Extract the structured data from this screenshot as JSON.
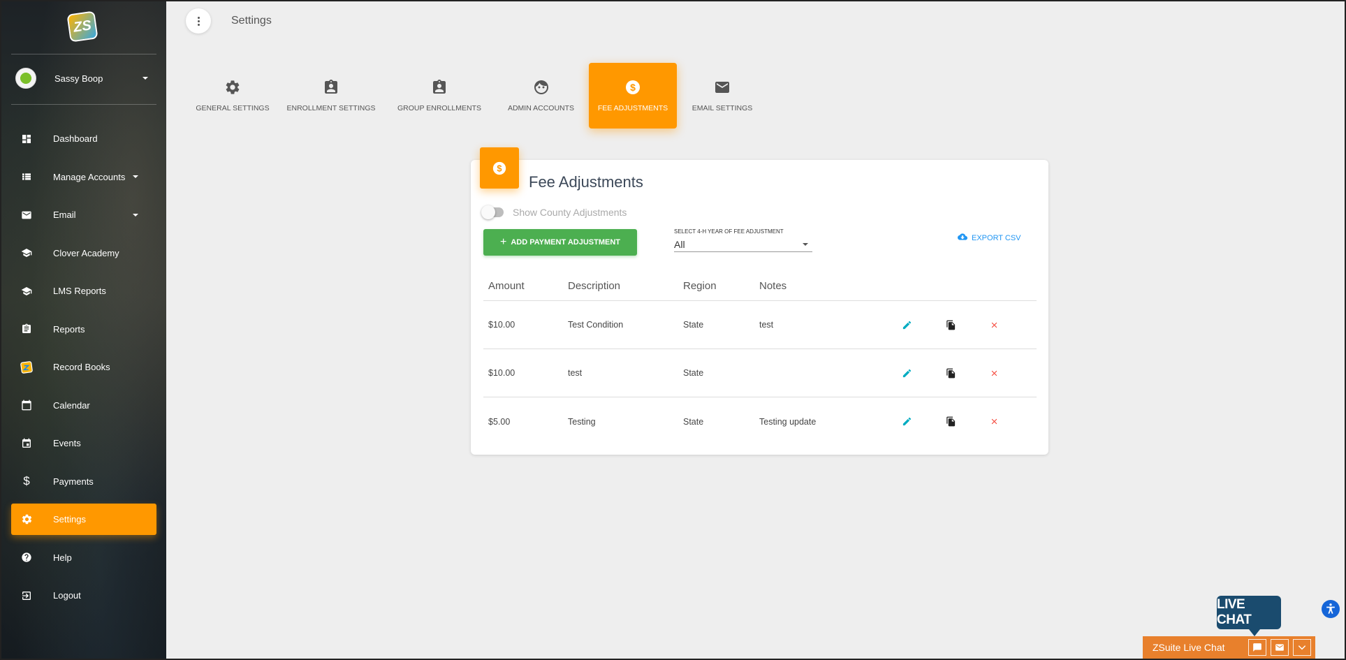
{
  "app": {
    "page_title": "Settings",
    "logo_text": "ZS"
  },
  "user": {
    "name": "Sassy Boop"
  },
  "sidebar": {
    "items": [
      {
        "label": "Dashboard",
        "icon": "dashboard-icon"
      },
      {
        "label": "Manage Accounts",
        "icon": "list-icon",
        "has_caret": true
      },
      {
        "label": "Email",
        "icon": "email-icon",
        "has_caret": true
      },
      {
        "label": "Clover Academy",
        "icon": "school-icon"
      },
      {
        "label": "LMS Reports",
        "icon": "school-icon"
      },
      {
        "label": "Reports",
        "icon": "clipboard-icon"
      },
      {
        "label": "Record Books",
        "icon": "zs-logo-icon"
      },
      {
        "label": "Calendar",
        "icon": "calendar-icon"
      },
      {
        "label": "Events",
        "icon": "event-icon"
      },
      {
        "label": "Payments",
        "icon": "dollar-icon"
      },
      {
        "label": "Settings",
        "icon": "gear-icon",
        "active": true
      },
      {
        "label": "Help",
        "icon": "help-icon"
      },
      {
        "label": "Logout",
        "icon": "logout-icon"
      }
    ]
  },
  "tabs": [
    {
      "label": "GENERAL SETTINGS",
      "icon": "gear-icon",
      "width": 0
    },
    {
      "label": "ENROLLMENT SETTINGS",
      "icon": "badge-icon"
    },
    {
      "label": "GROUP ENROLLMENTS",
      "icon": "badge-icon"
    },
    {
      "label": "ADMIN ACCOUNTS",
      "icon": "face-icon"
    },
    {
      "label": "FEE ADJUSTMENTS",
      "icon": "dollar-circle-icon",
      "active": true
    },
    {
      "label": "EMAIL SETTINGS",
      "icon": "email-icon"
    }
  ],
  "card": {
    "title": "Fee Adjustments",
    "toggle_label": "Show County Adjustments",
    "add_button": "ADD PAYMENT ADJUSTMENT",
    "select_label": "SELECT 4-H YEAR OF FEE ADJUSTMENT",
    "select_value": "All",
    "export_label": "EXPORT CSV",
    "columns": [
      "Amount",
      "Description",
      "Region",
      "Notes"
    ],
    "rows": [
      {
        "amount": "$10.00",
        "description": "Test Condition",
        "region": "State",
        "notes": "test"
      },
      {
        "amount": "$10.00",
        "description": "test",
        "region": "State",
        "notes": ""
      },
      {
        "amount": "$5.00",
        "description": "Testing",
        "region": "State",
        "notes": "Testing update"
      }
    ]
  },
  "chat": {
    "bubble": "LIVE CHAT",
    "bar_label": "ZSuite Live Chat"
  },
  "colors": {
    "accent": "#ff9800",
    "success": "#4caf50",
    "link": "#2196f3",
    "danger": "#f44336",
    "edit": "#00acc1",
    "chat": "#e8802c",
    "chat_bubble": "#1a4b6e"
  }
}
